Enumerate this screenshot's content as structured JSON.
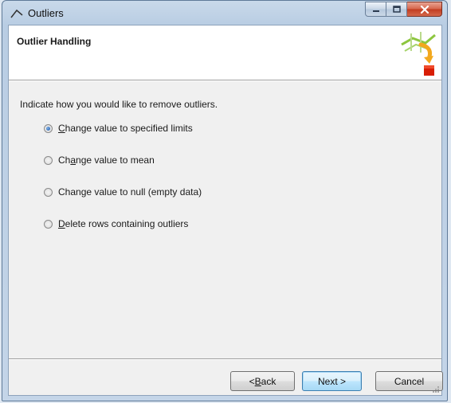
{
  "window": {
    "title": "Outliers"
  },
  "header": {
    "title": "Outlier Handling"
  },
  "main": {
    "instruction": "Indicate how you would like to remove outliers.",
    "options": [
      {
        "pre": "",
        "mnemonic": "C",
        "post": "hange value to specified limits",
        "selected": true
      },
      {
        "pre": "Ch",
        "mnemonic": "a",
        "post": "nge value to mean",
        "selected": false
      },
      {
        "pre": "Chan",
        "mnemonic": "g",
        "post": "e value to null (empty data)",
        "selected": false
      },
      {
        "pre": "",
        "mnemonic": "D",
        "post": "elete rows containing outliers",
        "selected": false
      }
    ]
  },
  "footer": {
    "back": {
      "pre": "< ",
      "mnemonic": "B",
      "post": "ack"
    },
    "next_label": "Next >",
    "cancel_label": "Cancel"
  },
  "colors": {
    "accent": "#1a56a6",
    "header_bg": "#ffffff",
    "client_bg": "#f0f0f0",
    "close_red": "#c13b1f"
  }
}
